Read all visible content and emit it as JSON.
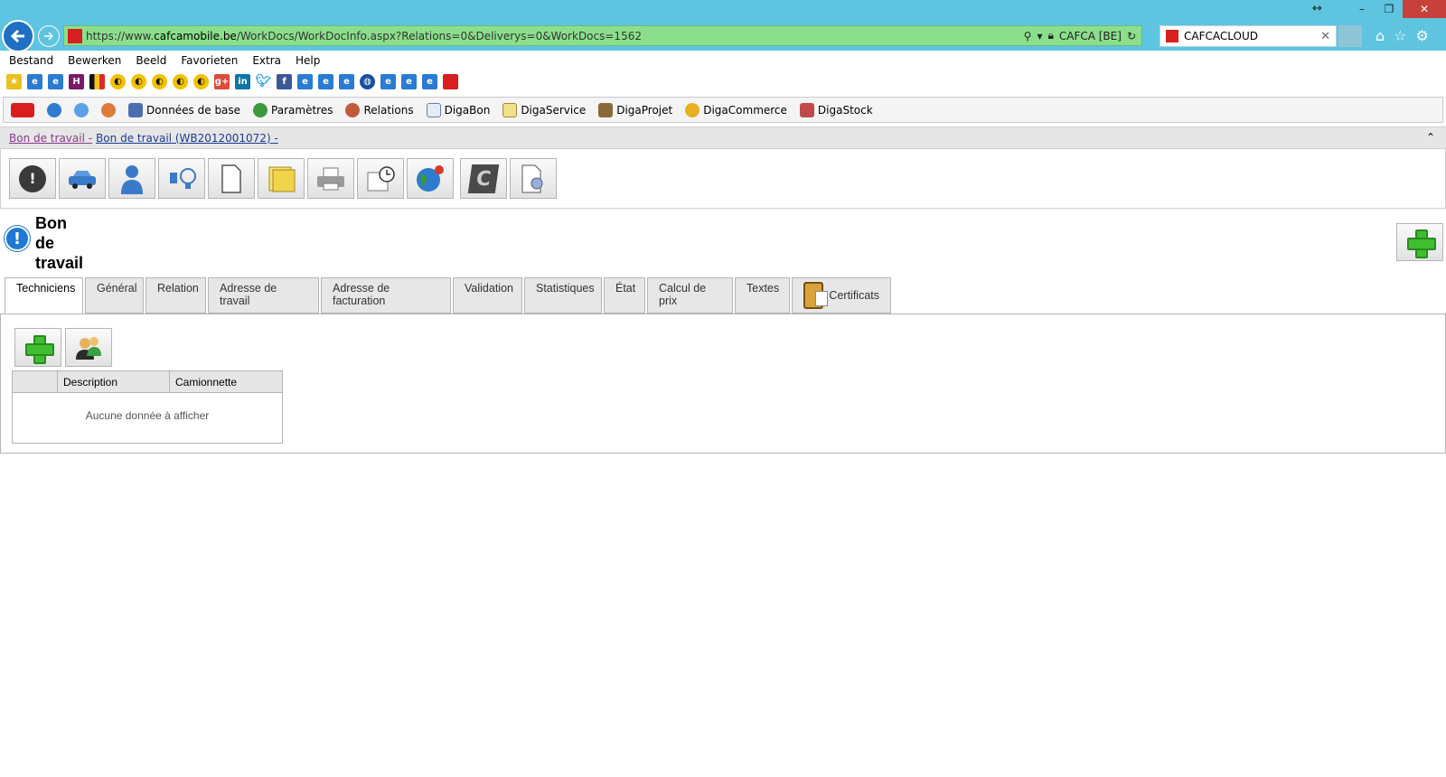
{
  "browser": {
    "url_prefix": "https://www.",
    "url_host": "cafcamobile.be",
    "url_path": "/WorkDocs/WorkDocInfo.aspx?Relations=0&Deliverys=0&WorkDocs=1562",
    "site_identity": "CAFCA [BE]",
    "tab_title": "CAFCACLOUD"
  },
  "menu": [
    "Bestand",
    "Bewerken",
    "Beeld",
    "Favorieten",
    "Extra",
    "Help"
  ],
  "app_toolbar": {
    "items": [
      "Données de base",
      "Paramètres",
      "Relations",
      "DigaBon",
      "DigaService",
      "DigaProjet",
      "DigaCommerce",
      "DigaStock"
    ]
  },
  "breadcrumb": {
    "part1": "Bon de travail -",
    "part2": "Bon de travail (WB2012001072) -"
  },
  "page": {
    "title_line1": "Bon",
    "title_line2": "de",
    "title_line3": "travail"
  },
  "tabs": [
    "Techniciens",
    "Général",
    "Relation",
    "Adresse de travail",
    "Adresse de facturation",
    "Validation",
    "Statistiques",
    "État",
    "Calcul de prix",
    "Textes",
    "Certificats"
  ],
  "grid": {
    "columns": [
      "",
      "Description",
      "Camionnette"
    ],
    "empty_text": "Aucune donnée à afficher"
  },
  "colors": {
    "titlebar": "#5ec4e0",
    "address_bar": "#8bdf8c",
    "accent_plus": "#3fbf2f"
  }
}
